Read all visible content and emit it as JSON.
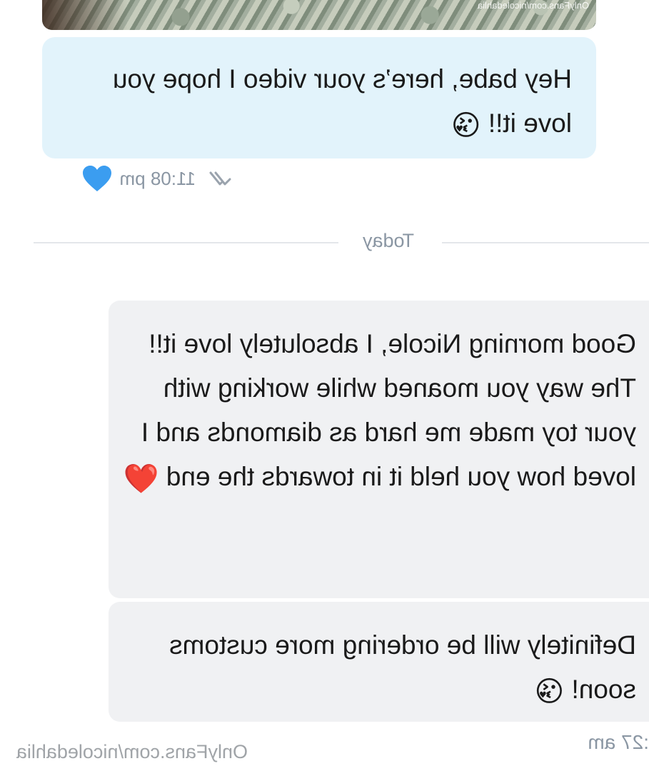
{
  "media": {
    "watermark": "OnlyFans.com/nicoledahlia"
  },
  "sent_message": {
    "text": "Hey babe, here’s your video I hope you love it!!",
    "emoji": "😘",
    "time": "11:08 pm",
    "reaction": "heart",
    "colors": {
      "bubble": "#e2f3fb",
      "heart": "#3b9df0"
    }
  },
  "date_divider": {
    "label": "Today"
  },
  "received_messages": [
    {
      "text": "Good morning Nicole, I absolutely love it!! The way you moaned while working with your toy made me hard as diamonds and I loved how you held it in towards the end",
      "emoji": "❤️"
    },
    {
      "text": "Definitely will be ordering more customs soon!",
      "emoji": "😘"
    }
  ],
  "received_time": ":27 am",
  "footer_watermark": "OnlyFans.com/nicoledahlia"
}
